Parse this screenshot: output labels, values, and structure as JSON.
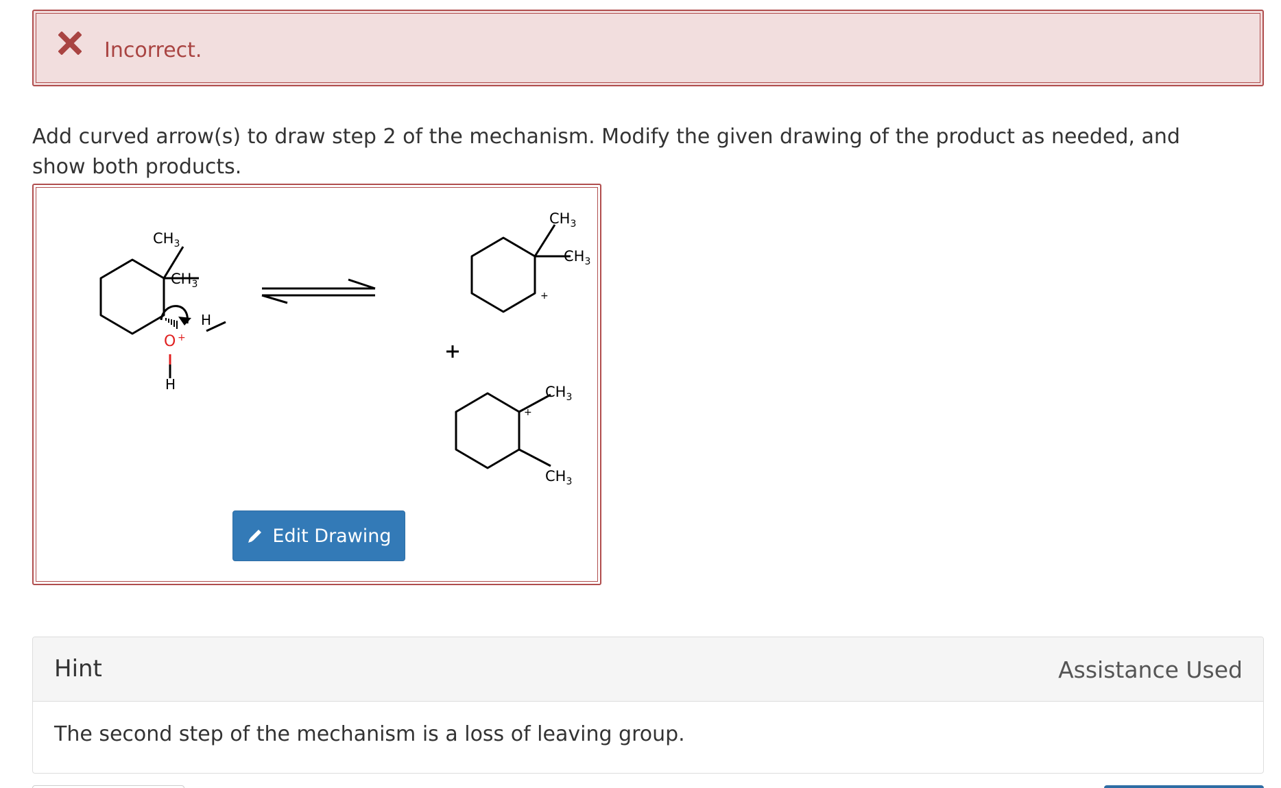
{
  "alert": {
    "icon": "x-icon",
    "text": "Incorrect.",
    "color": "#a94442"
  },
  "question": {
    "text": "Add curved arrow(s) to draw step 2 of the mechanism. Modify the given drawing of the product as needed, and show both products."
  },
  "drawing": {
    "labels": {
      "ch3": "CH",
      "sub3": "3",
      "h": "H",
      "o": "O",
      "plus": "+"
    },
    "edit_button": {
      "label": "Edit Drawing",
      "icon": "pencil-icon"
    }
  },
  "hint": {
    "title": "Hint",
    "status": "Assistance Used",
    "body": "The second step of the mechanism is a loss of leaving group."
  },
  "colors": {
    "error_border": "#b04d4d",
    "error_bg": "#f2dede",
    "button": "#337ab7",
    "oxygen": "#e02020"
  }
}
